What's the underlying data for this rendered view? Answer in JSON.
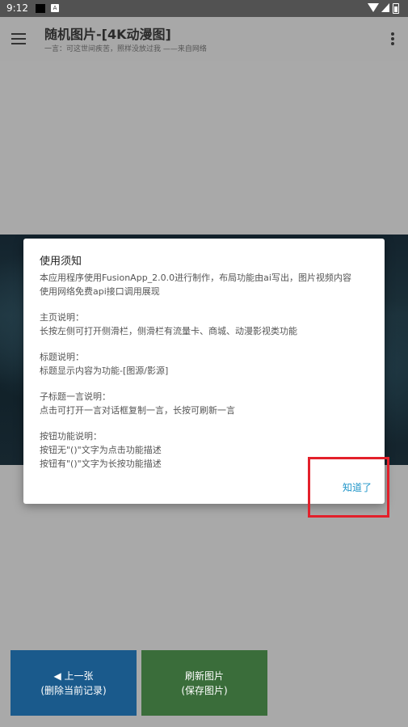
{
  "status_bar": {
    "time": "9:12",
    "notif_icon": "A"
  },
  "toolbar": {
    "title": "随机图片-[4K动漫图]",
    "subtitle": "一言：可这世间疾苦，照样没放过我  ——来自网络"
  },
  "buttons": {
    "prev_line1": "◀ 上一张",
    "prev_line2": "(删除当前记录)",
    "refresh_line1": "刷新图片",
    "refresh_line2": "(保存图片)"
  },
  "dialog": {
    "title": "使用须知",
    "p1_l1": "本应用程序使用FusionApp_2.0.0进行制作，布局功能由ai写出，图片视频内容",
    "p1_l2": "使用网络免费api接口调用展现",
    "p2_l1": "主页说明：",
    "p2_l2": "长按左侧可打开侧滑栏，侧滑栏有流量卡、商城、动漫影视类功能",
    "p3_l1": "标题说明：",
    "p3_l2": "标题显示内容为功能-[图源/影源]",
    "p4_l1": "子标题一言说明：",
    "p4_l2": "点击可打开一言对话框复制一言，长按可刷新一言",
    "p5_l1": "按钮功能说明：",
    "p5_l2": "按钮无\"()\"文字为点击功能描述",
    "p5_l3": "按钮有\"()\"文字为长按功能描述",
    "ok_label": "知道了"
  },
  "colors": {
    "highlight": "#e3202b",
    "accent": "#2196c9",
    "prev_button": "#1a5a8c",
    "refresh_button": "#3a6d3a"
  }
}
